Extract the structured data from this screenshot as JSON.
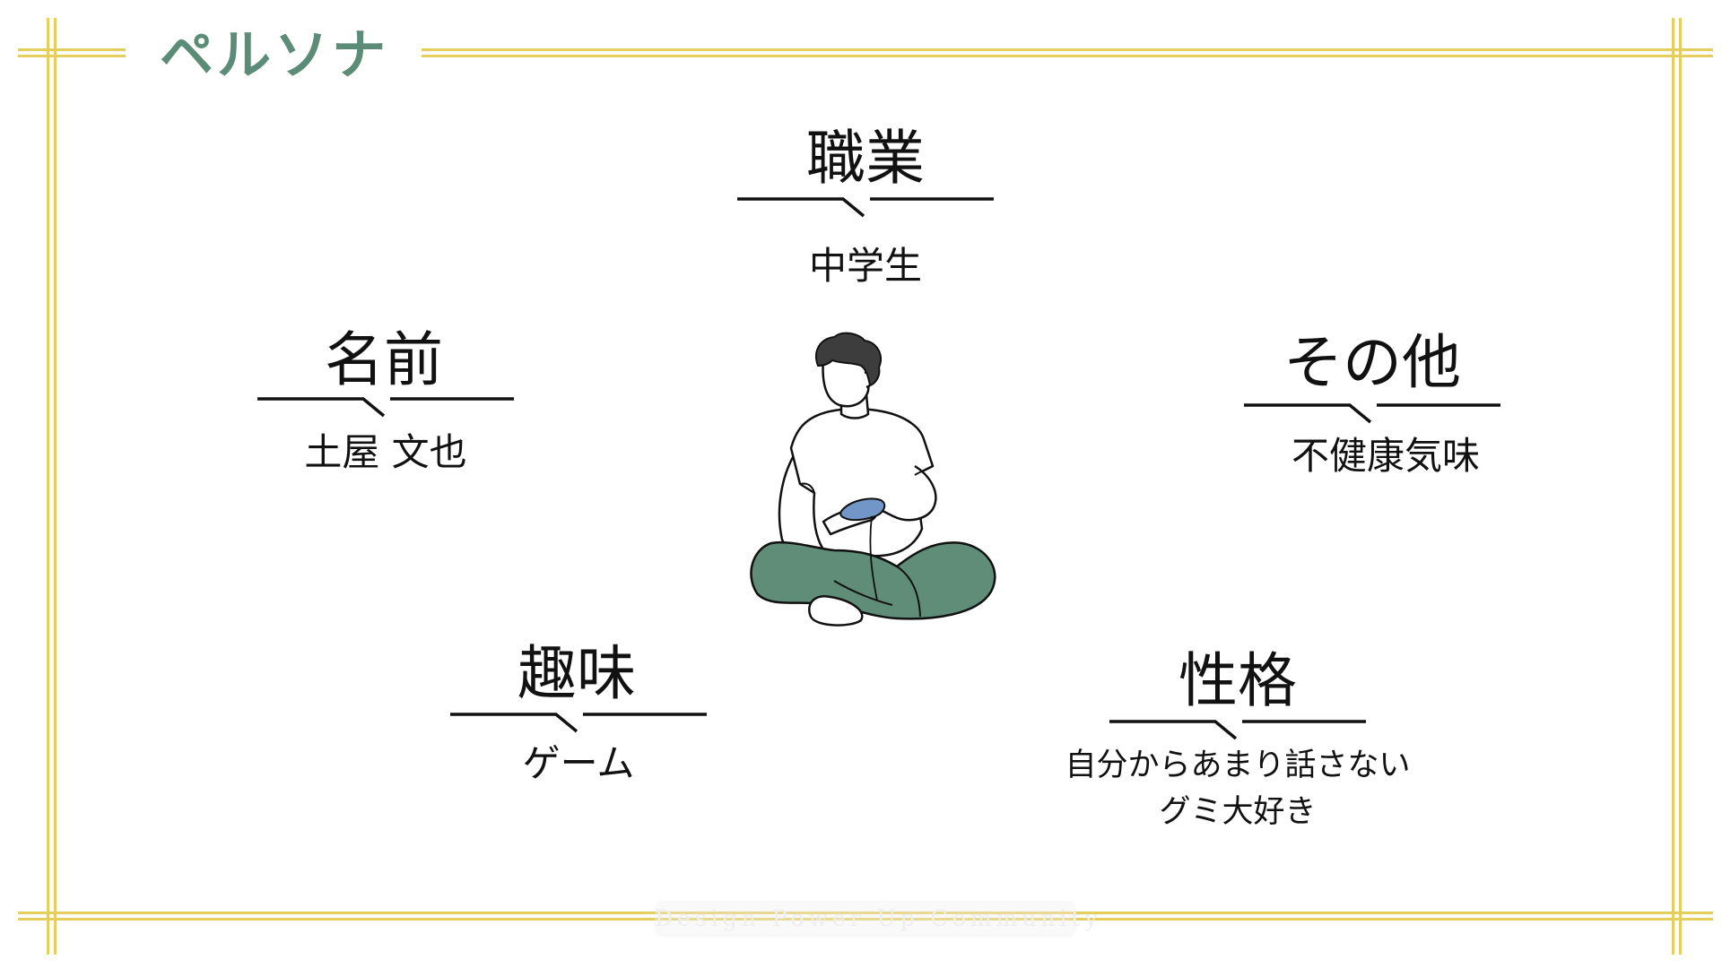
{
  "page": {
    "title": "ペルソナ",
    "watermark": "Design Power Up Community",
    "colors": {
      "frame": "#e4cf5e",
      "title": "#5b8c77",
      "pants": "#5f8d78",
      "hair": "#3d3d3d",
      "controller": "#7396c8"
    },
    "illustration": "person-sitting-playing-game"
  },
  "persona": {
    "job": {
      "label": "職業",
      "value": "中学生"
    },
    "name": {
      "label": "名前",
      "value": "土屋 文也"
    },
    "other": {
      "label": "その他",
      "value": "不健康気味"
    },
    "hobby": {
      "label": "趣味",
      "value": "ゲーム"
    },
    "personality": {
      "label": "性格",
      "values": [
        "自分からあまり話さない",
        "グミ大好き"
      ]
    }
  }
}
